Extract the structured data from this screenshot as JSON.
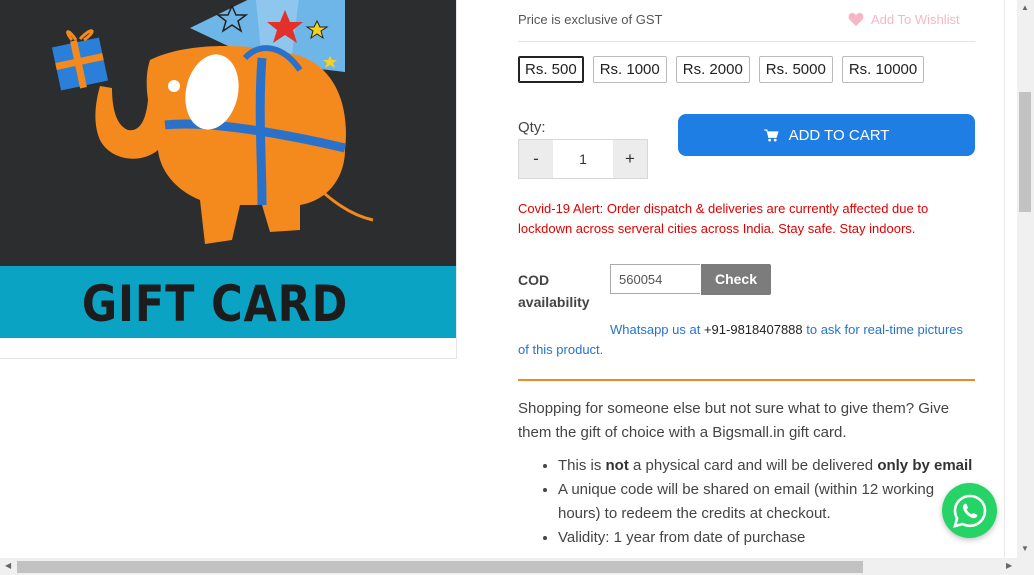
{
  "product_image": {
    "title": "GIFT CARD"
  },
  "price_note": "Price is exclusive of GST",
  "wishlist_label": "Add To Wishlist",
  "denominations": [
    "Rs. 500",
    "Rs. 1000",
    "Rs. 2000",
    "Rs. 5000",
    "Rs. 10000"
  ],
  "selected_denomination": "Rs. 500",
  "quantity": {
    "label": "Qty:",
    "minus": "-",
    "value": "1",
    "plus": "+"
  },
  "add_to_cart": "ADD TO CART",
  "covid_alert": "Covid-19 Alert: Order dispatch & deliveries are currently affected due to lockdown across serveral cities across India. Stay safe. Stay indoors.",
  "cod": {
    "label_line1": "COD",
    "label_line2": "availability",
    "pincode_value": "560054",
    "check_label": "Check"
  },
  "whatsapp": {
    "prefix": "Whatsapp us at ",
    "phone": "+91-9818407888",
    "suffix": " to ask for real-time pictures of this product."
  },
  "description": "Shopping for someone else but not sure what to give them? Give them the gift of choice with a Bigsmall.in gift card.",
  "bullets": {
    "b1_pre": "This is ",
    "b1_bold1": "not",
    "b1_mid": " a physical card and will be delivered ",
    "b1_bold2": "only by email",
    "b2": "A unique code will be shared on email (within 12 working hours) to redeem the credits at checkout.",
    "b3": "Validity: 1 year from date of purchase"
  },
  "colors": {
    "accent_blue": "#1f7ee3",
    "alert_red": "#e00000",
    "divider_orange": "#ef8a2c",
    "whatsapp_green": "#25d366"
  }
}
